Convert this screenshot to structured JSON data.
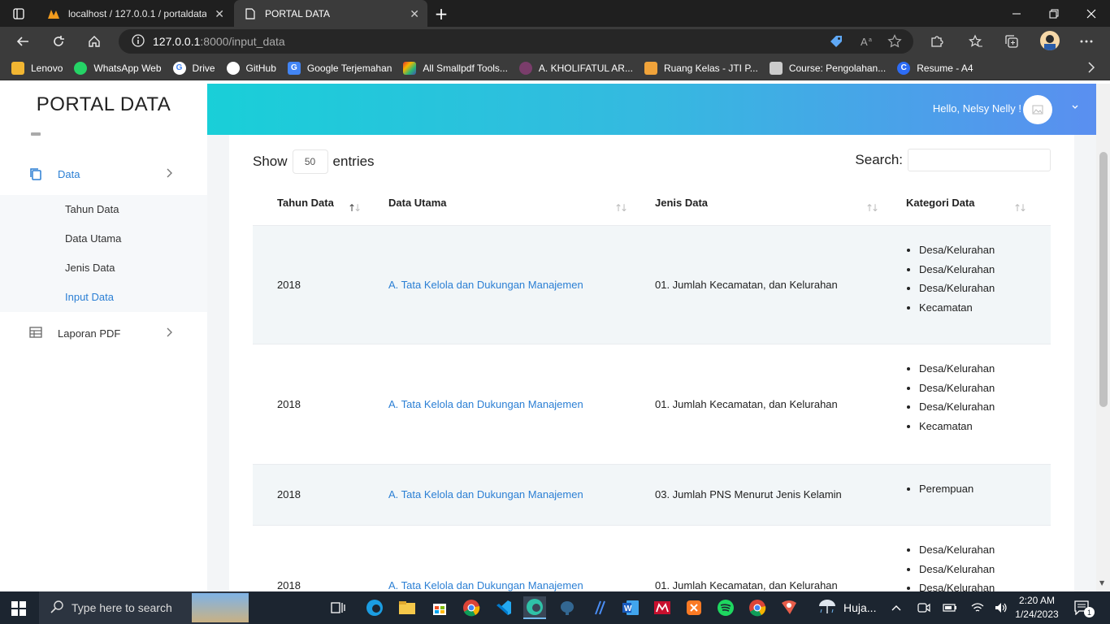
{
  "browser": {
    "tabs": [
      {
        "title": "localhost / 127.0.0.1 / portaldata",
        "close": "✕"
      },
      {
        "title": "PORTAL DATA",
        "close": "✕"
      }
    ],
    "new_tab": "+",
    "url_host": "127.0.0.1",
    "url_rest": ":8000/input_data",
    "bookmarks": [
      {
        "label": "Lenovo",
        "color": "#f2b632"
      },
      {
        "label": "WhatsApp Web",
        "color": "#25d366"
      },
      {
        "label": "Drive",
        "color": "#4285f4"
      },
      {
        "label": "GitHub",
        "color": "#ffffff"
      },
      {
        "label": "Google Terjemahan",
        "color": "#4285f4"
      },
      {
        "label": "All Smallpdf Tools...",
        "color": "#e5322d"
      },
      {
        "label": "A. KHOLIFATUL AR...",
        "color": "#7a3d6b"
      },
      {
        "label": "Ruang Kelas - JTI P...",
        "color": "#f0a33a"
      },
      {
        "label": "Course: Pengolahan...",
        "color": "#cccccc"
      },
      {
        "label": "Resume - A4",
        "color": "#2d6cf5"
      }
    ]
  },
  "sidebar": {
    "brand": "PORTAL DATA",
    "data_label": "Data",
    "submenu": [
      "Tahun Data",
      "Data Utama",
      "Jenis Data",
      "Input Data"
    ],
    "laporan_label": "Laporan PDF"
  },
  "topbar": {
    "greeting": "Hello, Nelsy Nelly !"
  },
  "table": {
    "show_label": "Show",
    "entries_value": "50",
    "entries_label": "entries",
    "search_label": "Search:",
    "headers": [
      "Tahun Data",
      "Data Utama",
      "Jenis Data",
      "Kategori Data"
    ],
    "rows": [
      {
        "tahun": "2018",
        "utama": "A. Tata Kelola dan Dukungan Manajemen",
        "jenis": "01. Jumlah Kecamatan, dan Kelurahan",
        "kategori": [
          "Desa/Kelurahan",
          "Desa/Kelurahan",
          "Desa/Kelurahan",
          "Kecamatan"
        ]
      },
      {
        "tahun": "2018",
        "utama": "A. Tata Kelola dan Dukungan Manajemen",
        "jenis": "01. Jumlah Kecamatan, dan Kelurahan",
        "kategori": [
          "Desa/Kelurahan",
          "Desa/Kelurahan",
          "Desa/Kelurahan",
          "Kecamatan"
        ]
      },
      {
        "tahun": "2018",
        "utama": "A. Tata Kelola dan Dukungan Manajemen",
        "jenis": "03. Jumlah PNS Menurut Jenis Kelamin",
        "kategori": [
          "Perempuan"
        ]
      },
      {
        "tahun": "2018",
        "utama": "A. Tata Kelola dan Dukungan Manajemen",
        "jenis": "01. Jumlah Kecamatan, dan Kelurahan",
        "kategori": [
          "Desa/Kelurahan",
          "Desa/Kelurahan",
          "Desa/Kelurahan"
        ]
      }
    ]
  },
  "taskbar": {
    "search_placeholder": "Type here to search",
    "weather": "Huja...",
    "time": "2:20 AM",
    "date": "1/24/2023",
    "notifications": "1"
  }
}
